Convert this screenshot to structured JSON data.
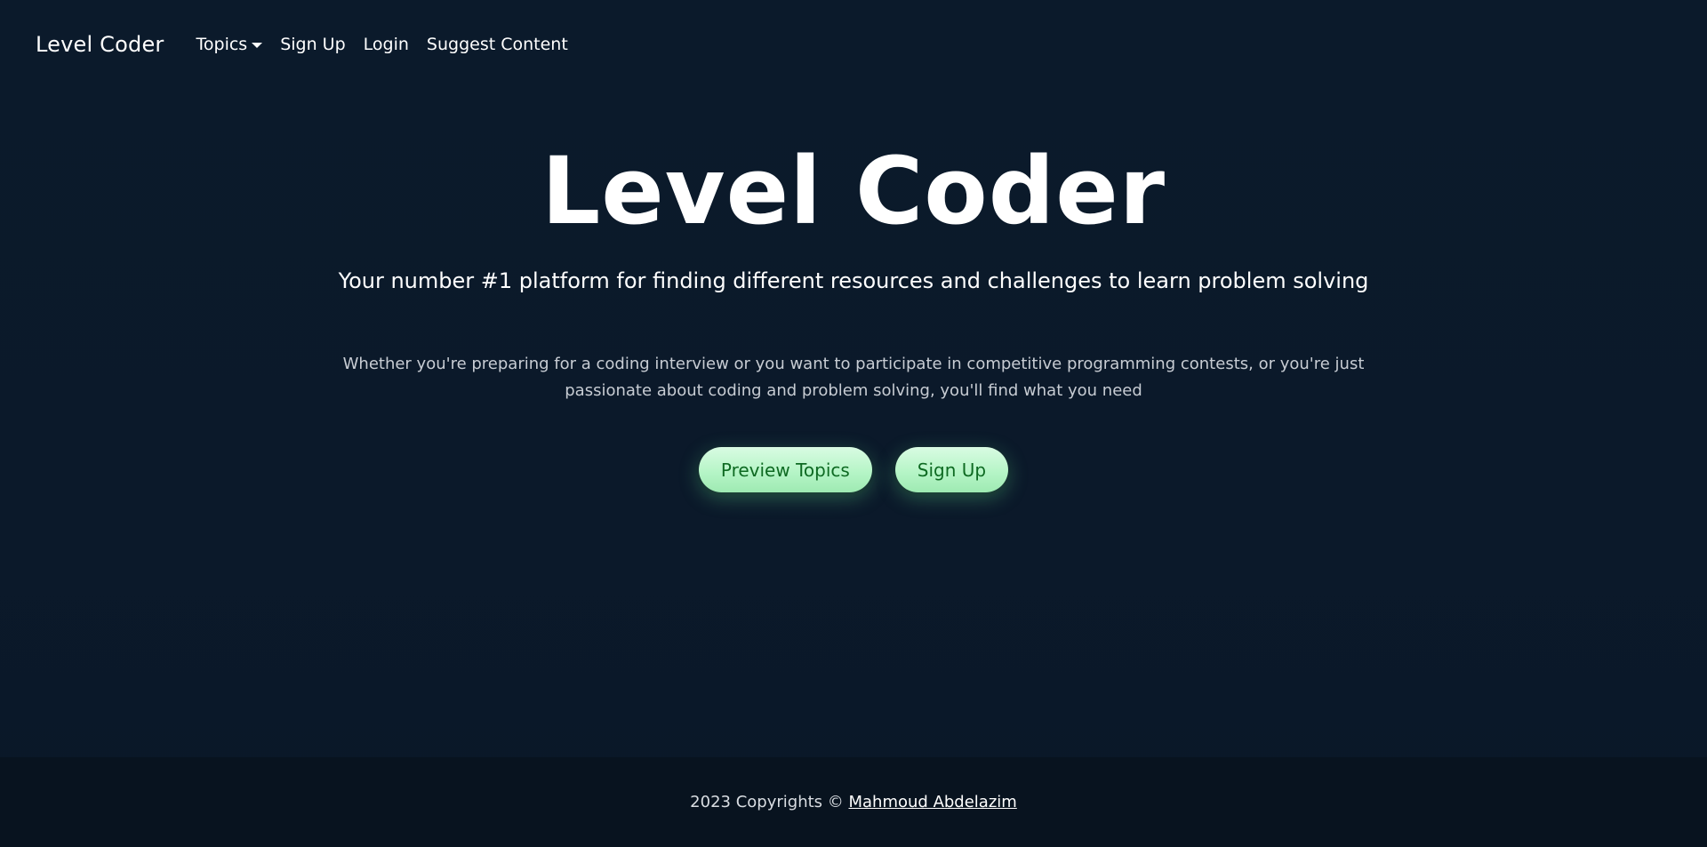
{
  "navbar": {
    "brand": "Level Coder",
    "links": [
      {
        "label": "Topics",
        "has_dropdown": true
      },
      {
        "label": "Sign Up"
      },
      {
        "label": "Login"
      },
      {
        "label": "Suggest Content"
      }
    ]
  },
  "hero": {
    "title": "Level Coder",
    "subtitle": "Your number #1 platform for finding different resources and challenges to learn problem solving",
    "description": "Whether you're preparing for a coding interview or you want to participate in competitive programming contests, or you're just passionate about coding and problem solving, you'll find what you need",
    "buttons": {
      "preview": "Preview Topics",
      "signup": "Sign Up"
    }
  },
  "footer": {
    "prefix": "2023 Copyrights ©",
    "author": "Mahmoud Abdelazim"
  },
  "colors": {
    "background": "#0b1a2b",
    "footer_background": "#08131f",
    "button_background": "#b6f5c7",
    "button_text": "#0e6a22"
  },
  "icons": {
    "topics_dropdown": "caret-down-icon"
  }
}
